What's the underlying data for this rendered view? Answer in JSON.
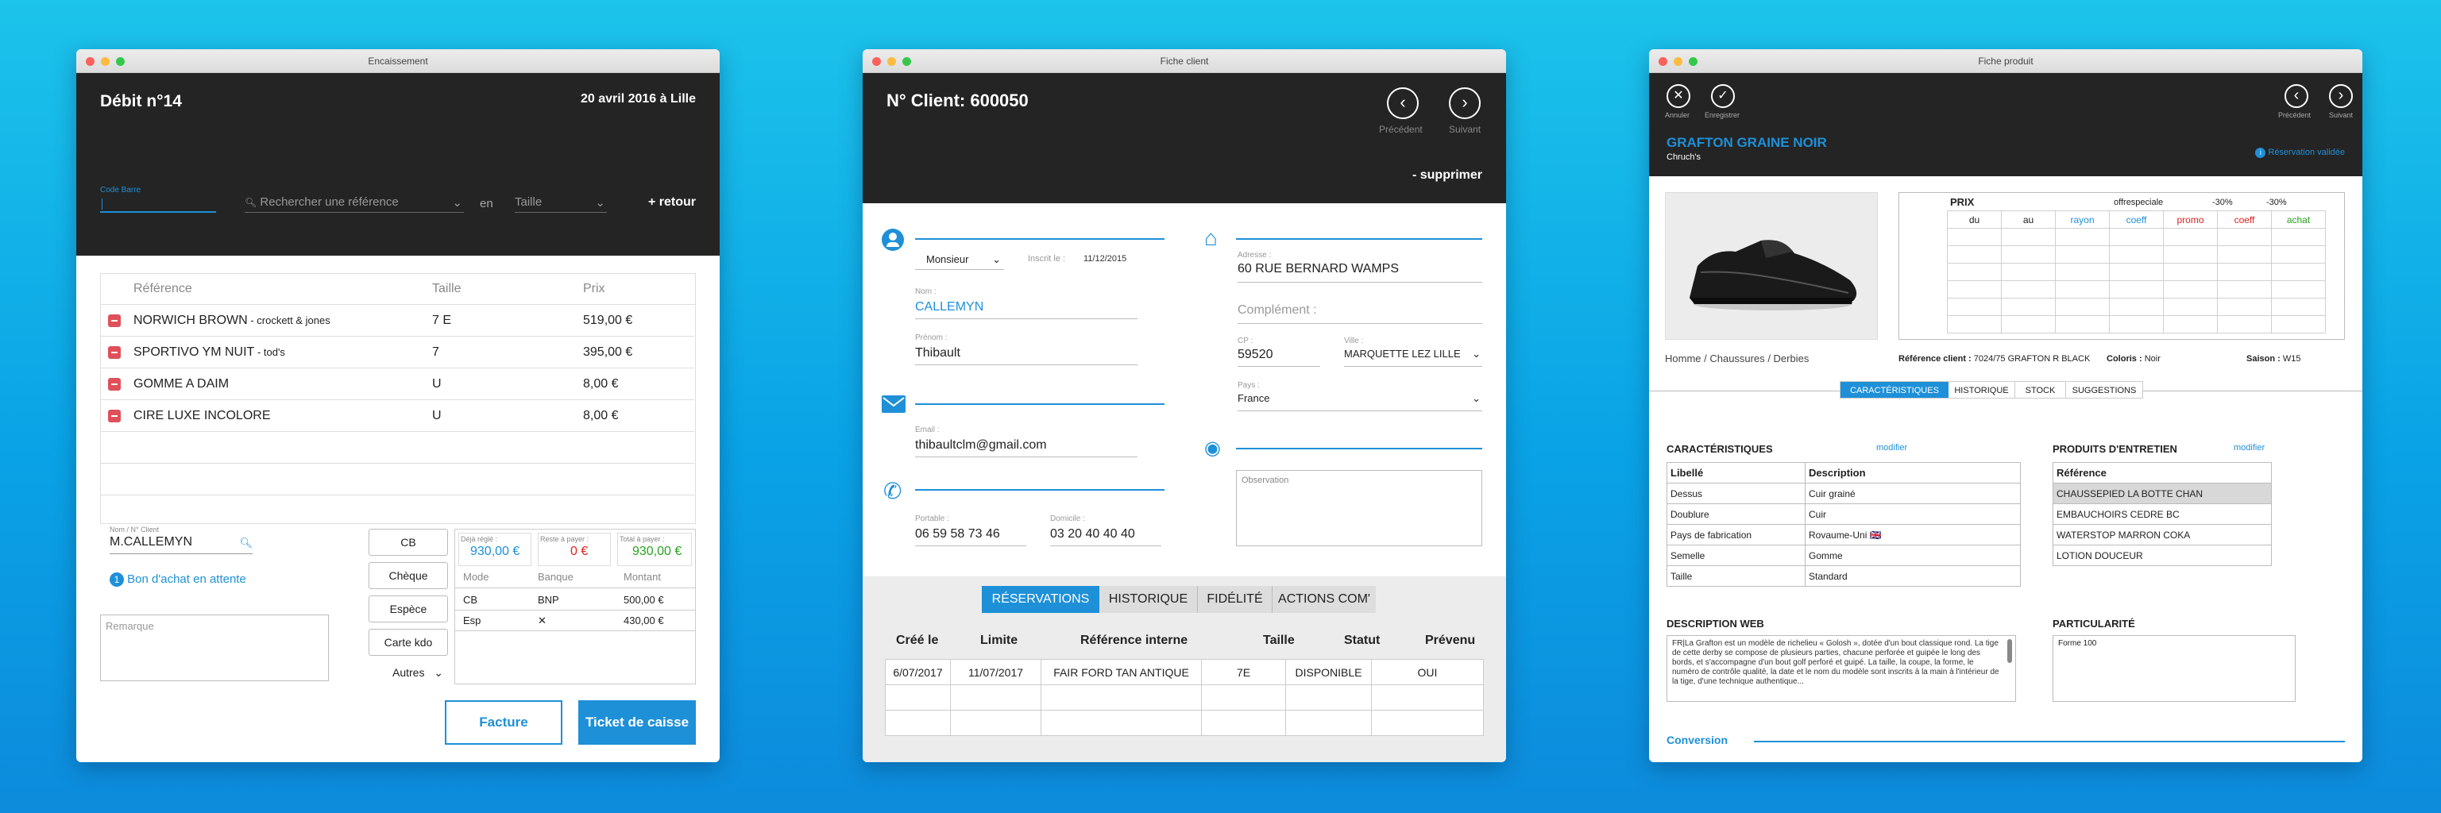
{
  "w1": {
    "title": "Encaissement",
    "heading": "Débit n°14",
    "date": "20 avril 2016 à Lille",
    "code_label": "Code Barre",
    "search_placeholder": "Rechercher une référence",
    "en": "en",
    "taille_placeholder": "Taille",
    "retour": "+ retour",
    "cols": [
      "Référence",
      "Taille",
      "Prix"
    ],
    "rows": [
      {
        "ref": "NORWICH BROWN",
        "sub": " - crockett & jones",
        "taille": "7 E",
        "prix": "519,00 €"
      },
      {
        "ref": "SPORTIVO YM NUIT",
        "sub": " - tod's",
        "taille": "7",
        "prix": "395,00 €"
      },
      {
        "ref": "GOMME A DAIM",
        "sub": "",
        "taille": "U",
        "prix": "8,00 €"
      },
      {
        "ref": "CIRE LUXE INCOLORE",
        "sub": "",
        "taille": "U",
        "prix": "8,00 €"
      }
    ],
    "client_label": "Nom / N° Client",
    "client_value": "M.CALLEMYN",
    "bon_num": "1",
    "bon_label": "Bon d'achat en attente",
    "remarque": "Remarque",
    "pay_buttons": [
      "CB",
      "Chèque",
      "Espèce",
      "Carte kdo"
    ],
    "autres": "Autres",
    "deja_label": "Déjà réglé :",
    "deja_value": "930,00 €",
    "reste_label": "Reste à payer :",
    "reste_value": "0 €",
    "total_label": "Total à payer :",
    "total_value": "930,00 €",
    "pay_cols": [
      "Mode",
      "Banque",
      "Montant"
    ],
    "pay_rows": [
      {
        "mode": "CB",
        "banque": "BNP",
        "montant": "500,00 €"
      },
      {
        "mode": "Esp",
        "banque": "✕",
        "montant": "430,00 €"
      }
    ],
    "facture": "Facture",
    "ticket": "Ticket de caisse",
    "accent": "#1e90d8"
  },
  "w2": {
    "title": "Fiche client",
    "heading": "N° Client: 600050",
    "prev": "Précédent",
    "next": "Suivant",
    "supprimer": "- supprimer",
    "civilite": "Monsieur",
    "inscrit_label": "Inscrit le :",
    "inscrit_value": "11/12/2015",
    "nom_label": "Nom :",
    "nom_value": "CALLEMYN",
    "prenom_label": "Prénom :",
    "prenom_value": "Thibault",
    "email_label": "Email :",
    "email_value": "thibaultclm@gmail.com",
    "portable_label": "Portable :",
    "portable_value": "06 59 58 73 46",
    "domicile_label": "Domicile :",
    "domicile_value": "03 20 40 40 40",
    "adresse_label": "Adresse :",
    "adresse_value": "60 RUE BERNARD WAMPS",
    "complement": "Complément :",
    "cp_label": "CP :",
    "cp_value": "59520",
    "ville_label": "Ville :",
    "ville_value": "MARQUETTE LEZ LILLE",
    "pays_label": "Pays :",
    "pays_value": "France",
    "observation": "Observation",
    "tabs": [
      "RÉSERVATIONS",
      "HISTORIQUE",
      "FIDÉLITÉ",
      "ACTIONS COM'"
    ],
    "cols": [
      "Créé le",
      "Limite",
      "Référence interne",
      "Taille",
      "Statut",
      "Prévenu"
    ],
    "rows": [
      [
        "6/07/2017",
        "11/07/2017",
        "FAIR FORD TAN ANTIQUE",
        "7E",
        "DISPONIBLE",
        "OUI"
      ]
    ]
  },
  "w3": {
    "title": "Fiche produit",
    "annuler": "Annuler",
    "enregistrer": "Enregistrer",
    "prev": "Précédent",
    "next": "Suivant",
    "product": "GRAFTON GRAINE NOIR",
    "brand": "Chruch's",
    "reservation": "Réservation validée",
    "prix": "PRIX",
    "offre": "offrespeciale",
    "pct1": "-30%",
    "pct2": "-30%",
    "prix_cols": [
      "du",
      "au",
      "rayon",
      "coeff",
      "promo",
      "coeff",
      "achat"
    ],
    "category": "Homme / Chaussures / Derbies",
    "refclient_label": "Référence client :",
    "refclient_value": "7024/75 GRAFTON R BLACK",
    "coloris_label": "Coloris :",
    "coloris_value": "Noir",
    "saison_label": "Saison :",
    "saison_value": "W15",
    "tabs": [
      "CARACTÉRISTIQUES",
      "HISTORIQUE",
      "STOCK",
      "SUGGESTIONS"
    ],
    "carac_title": "CARACTÉRISTIQUES",
    "modifier": "modifier",
    "carac_cols": [
      "Libellé",
      "Description"
    ],
    "carac_rows": [
      [
        "Dessus",
        "Cuir grainé"
      ],
      [
        "Doublure",
        "Cuir"
      ],
      [
        "Pays de fabrication",
        "Rovaume-Uni 🇬🇧"
      ],
      [
        "Semelle",
        "Gomme"
      ],
      [
        "Taille",
        "Standard"
      ]
    ],
    "entretien_title": "PRODUITS D'ENTRETIEN",
    "entretien_col": "Référence",
    "entretien_rows": [
      "CHAUSSEPIED LA BOTTE CHAN",
      "EMBAUCHOIRS CEDRE BC",
      "WATERSTOP MARRON COKA",
      "LOTION DOUCEUR"
    ],
    "desc_title": "DESCRIPTION WEB",
    "desc_text": "FR|La Grafton est un modèle de richelieu « Golosh », dotée d'un bout classique rond. La tige de cette derby se compose de plusieurs parties, chacune perforée et guipée le long des bords, et s'accompagne d'un bout golf perforé et guipé. La taille, la coupe, la forme, le numéro de contrôle qualité, la date et le nom du modèle sont inscrits à la main à l'intérieur de la tige, d'une technique authentique...",
    "partic_title": "PARTICULARITÉ",
    "partic_text": "Forme 100",
    "conversion": "Conversion",
    "colors": {
      "rayon": "#1e90d8",
      "promo": "#e02020",
      "coeff2": "#e02020",
      "achat": "#2aa020"
    }
  }
}
